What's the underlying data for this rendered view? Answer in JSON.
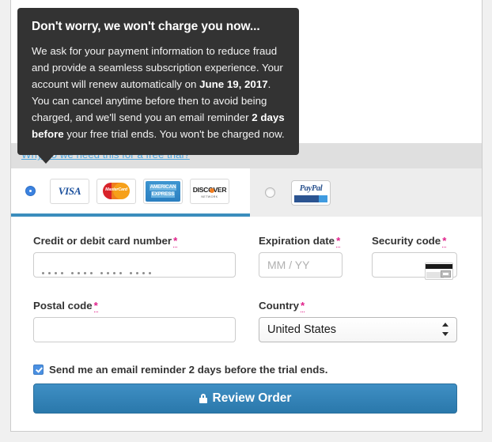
{
  "tooltip": {
    "title": "Don't worry, we won't charge you now...",
    "body_1": "We ask for your payment information to reduce fraud and provide a seamless subscription experience. Your account will renew automatically on ",
    "renew_date": "June 19, 2017",
    "body_2": ". You can cancel anytime before then to avoid being charged, and we'll send you an email reminder ",
    "days_before": "2 days before",
    "body_3": " your free trial ends. You won't be charged now."
  },
  "header": {
    "why_link": "Why do we need this for a free trial?"
  },
  "payment_tabs": [
    {
      "id": "credit-card",
      "selected": true,
      "cards": [
        {
          "name": "visa",
          "label": "VISA"
        },
        {
          "name": "mastercard",
          "label": "MasterCard"
        },
        {
          "name": "american-express",
          "label_top": "AMERICAN",
          "label_bottom": "EXPRESS"
        },
        {
          "name": "discover",
          "label": "DISCOVER",
          "sublabel": "NETWORK"
        }
      ]
    },
    {
      "id": "paypal",
      "selected": false,
      "logo_label": "PayPal"
    }
  ],
  "form": {
    "card_number": {
      "label": "Credit or debit card number",
      "required_mark": "*",
      "value": "",
      "placeholder": "",
      "mask_groups": 4,
      "mask_dots_per_group": 4
    },
    "expiration": {
      "label": "Expiration date",
      "required_mark": "*",
      "value": "",
      "placeholder": "MM / YY"
    },
    "security_code": {
      "label": "Security code",
      "required_mark": "*",
      "value": "",
      "placeholder": "",
      "icon": "card-back-cvv-icon"
    },
    "postal_code": {
      "label": "Postal code",
      "required_mark": "*",
      "value": "",
      "placeholder": ""
    },
    "country": {
      "label": "Country",
      "required_mark": "*",
      "selected": "United States"
    },
    "email_reminder": {
      "label": "Send me an email reminder 2 days before the trial ends.",
      "checked": true
    },
    "submit": {
      "label": "Review Order",
      "icon": "lock-icon"
    }
  },
  "colors": {
    "accent_blue": "#3b8dbd",
    "link_blue": "#4ea6de",
    "required_pink": "#e0218a",
    "tooltip_bg": "#333333",
    "button_blue": "#2a78ab",
    "checkbox_blue": "#4a90e2"
  }
}
